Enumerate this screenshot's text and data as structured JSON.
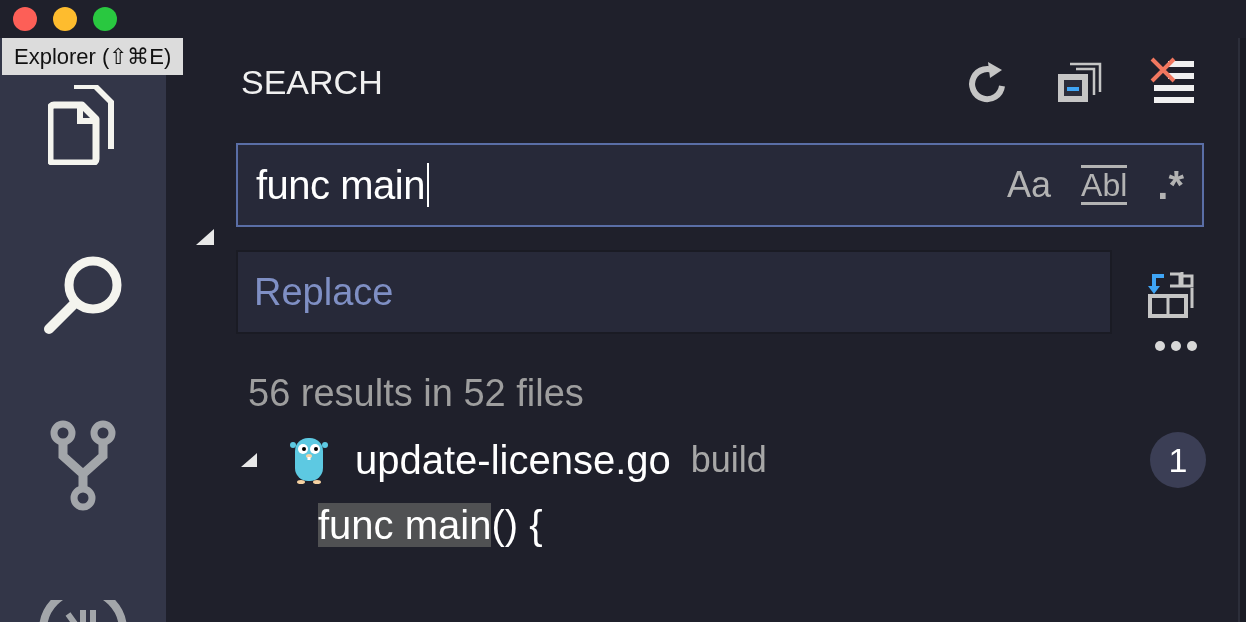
{
  "window": {
    "controls": [
      {
        "color": "#fd5f57"
      },
      {
        "color": "#febc2e"
      },
      {
        "color": "#29c840"
      }
    ]
  },
  "tooltip": {
    "text": "Explorer (⇧⌘E)"
  },
  "activity_bar": {
    "items": [
      {
        "kind": "explorer",
        "dimmed": false
      },
      {
        "kind": "search",
        "dimmed": false
      },
      {
        "kind": "source-control",
        "dimmed": true
      },
      {
        "kind": "extensions",
        "dimmed": true
      }
    ]
  },
  "search_panel": {
    "title": "SEARCH",
    "actions": [
      {
        "kind": "refresh"
      },
      {
        "kind": "collapse-all"
      },
      {
        "kind": "clear"
      }
    ],
    "replace_expanded": true,
    "search_field": {
      "value": "func main",
      "toggles": [
        {
          "kind": "case",
          "label": "Aa"
        },
        {
          "kind": "word",
          "label": "Abl"
        },
        {
          "kind": "regex",
          "label": ".*"
        }
      ]
    },
    "replace_field": {
      "placeholder": "Replace"
    },
    "summary": "56 results in 52 files",
    "results": [
      {
        "file": "update-license.go",
        "folder": "build",
        "count": "1",
        "expanded": true,
        "children": [
          {
            "match": "func main",
            "after": "() {"
          }
        ]
      }
    ]
  }
}
